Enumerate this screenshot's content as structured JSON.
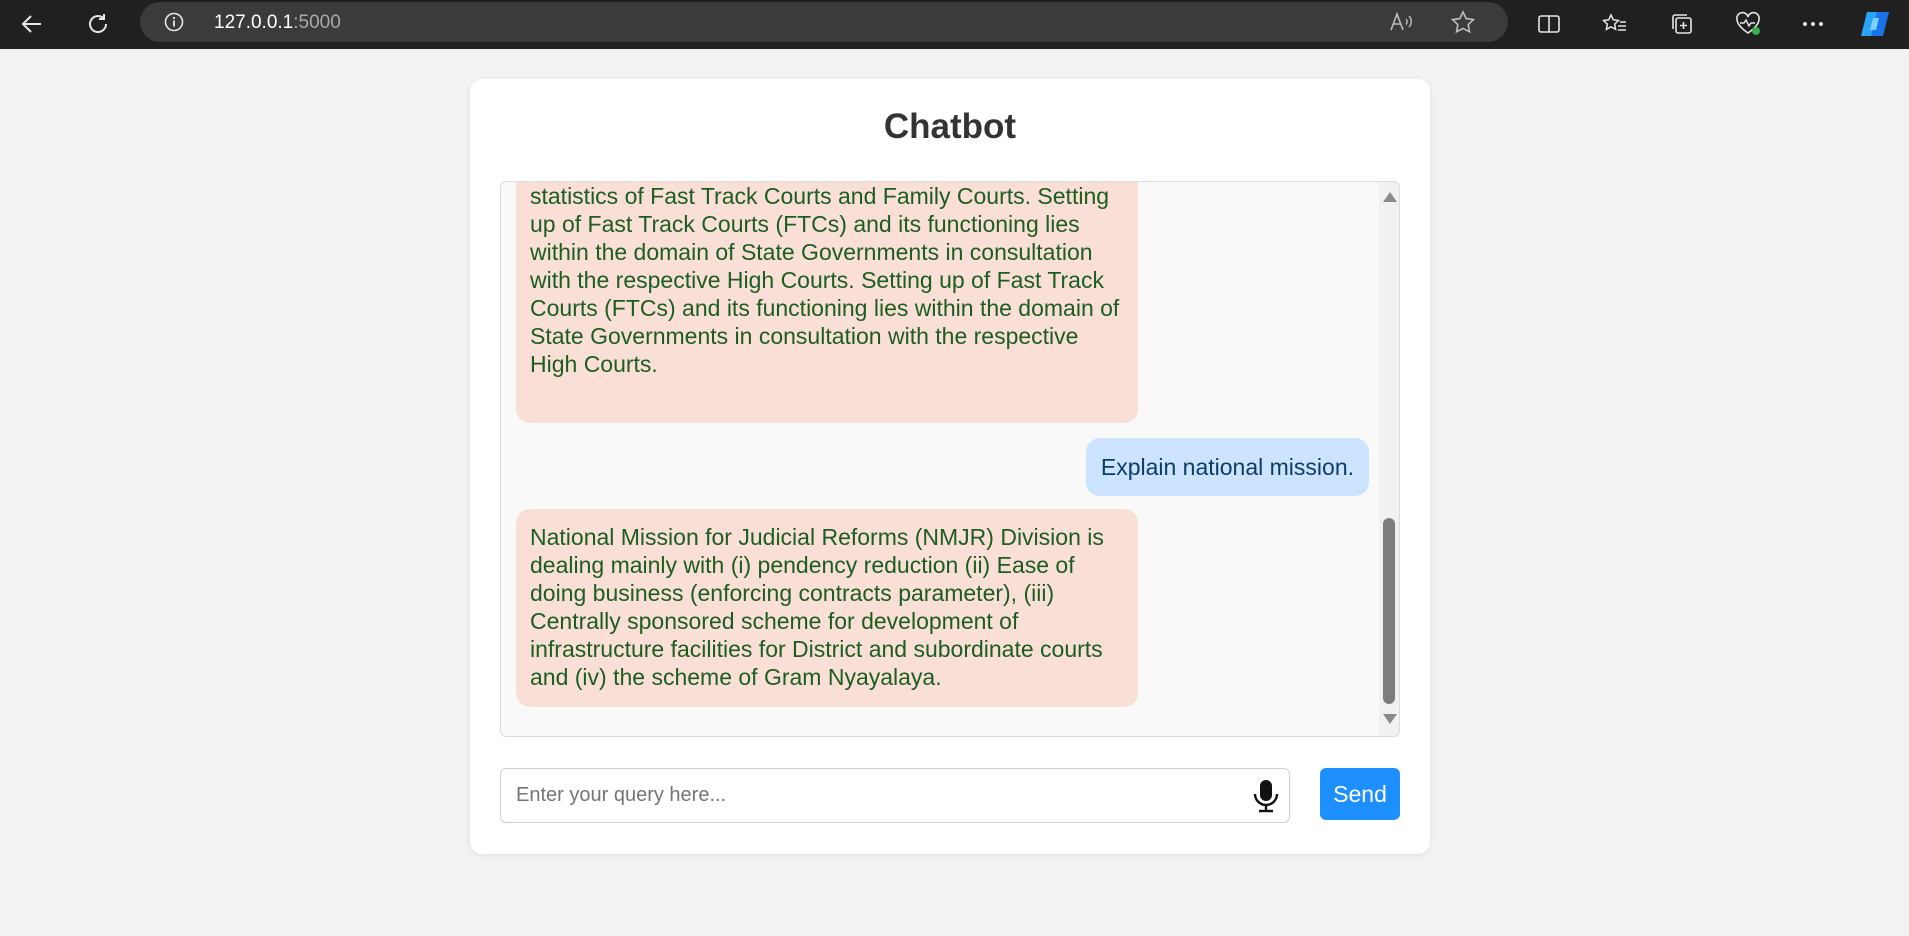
{
  "browser": {
    "url_host": "127.0.0.1",
    "url_port": ":5000"
  },
  "app": {
    "title": "Chatbot"
  },
  "messages": [
    {
      "role": "bot",
      "text": "statistics of Fast Track Courts and Family Courts. Setting up of Fast Track Courts (FTCs) and its functioning lies within the domain of State Governments in consultation with the respective High Courts. Setting up of Fast Track Courts (FTCs) and its functioning lies within the domain of State Governments in consultation with the respective High Courts."
    },
    {
      "role": "user",
      "text": "Explain national mission."
    },
    {
      "role": "bot",
      "text": "National Mission for Judicial Reforms (NMJR) Division is dealing mainly with (i) pendency reduction (ii) Ease of doing business (enforcing contracts parameter), (iii) Centrally sponsored scheme for development of infrastructure facilities for District and subordinate courts and (iv) the scheme of Gram Nyayalaya."
    }
  ],
  "composer": {
    "placeholder": "Enter your query here...",
    "value": "",
    "send_label": "Send"
  },
  "colors": {
    "bot_bubble": "#fadfd6",
    "bot_text": "#1b5e20",
    "user_bubble": "#cce4ff",
    "user_text": "#0b3d6b",
    "send_button": "#1e8fff"
  }
}
